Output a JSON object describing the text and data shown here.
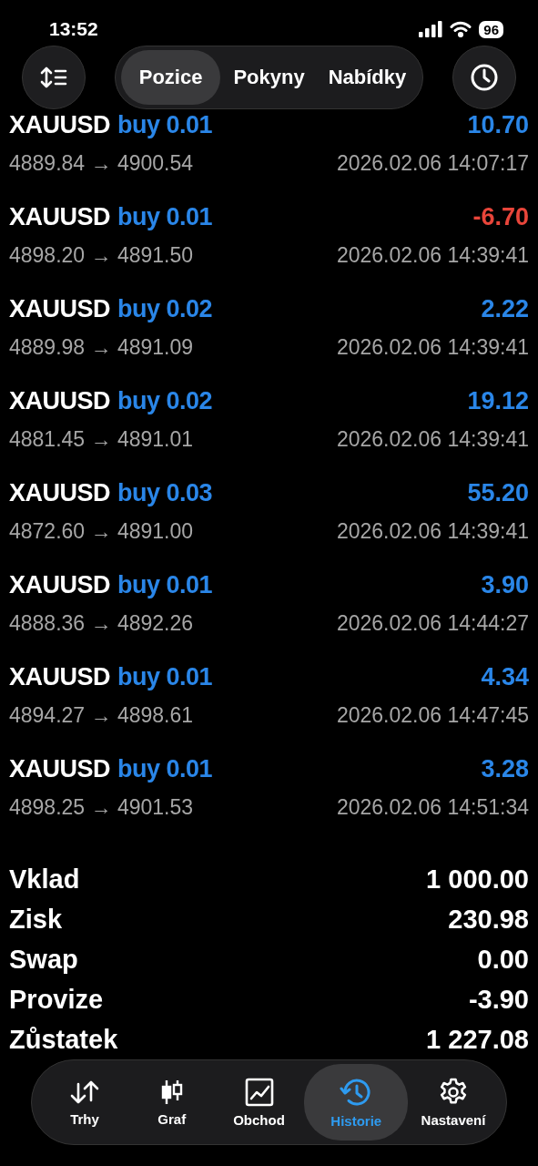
{
  "status_bar": {
    "time": "13:52",
    "battery": "96"
  },
  "header": {
    "tabs": [
      {
        "label": "Pozice",
        "selected": true
      },
      {
        "label": "Pokyny",
        "selected": false
      },
      {
        "label": "Nabídky",
        "selected": false
      }
    ]
  },
  "deals": [
    {
      "symbol": "XAUUSD",
      "side": "buy 0.01",
      "profit": "10.70",
      "kind": "gain",
      "prices": "4889.84 → 4900.54",
      "time": "2026.02.06 14:07:17"
    },
    {
      "symbol": "XAUUSD",
      "side": "buy 0.01",
      "profit": "-6.70",
      "kind": "loss",
      "prices": "4898.20 → 4891.50",
      "time": "2026.02.06 14:39:41"
    },
    {
      "symbol": "XAUUSD",
      "side": "buy 0.02",
      "profit": "2.22",
      "kind": "gain",
      "prices": "4889.98 → 4891.09",
      "time": "2026.02.06 14:39:41"
    },
    {
      "symbol": "XAUUSD",
      "side": "buy 0.02",
      "profit": "19.12",
      "kind": "gain",
      "prices": "4881.45 → 4891.01",
      "time": "2026.02.06 14:39:41"
    },
    {
      "symbol": "XAUUSD",
      "side": "buy 0.03",
      "profit": "55.20",
      "kind": "gain",
      "prices": "4872.60 → 4891.00",
      "time": "2026.02.06 14:39:41"
    },
    {
      "symbol": "XAUUSD",
      "side": "buy 0.01",
      "profit": "3.90",
      "kind": "gain",
      "prices": "4888.36 → 4892.26",
      "time": "2026.02.06 14:44:27"
    },
    {
      "symbol": "XAUUSD",
      "side": "buy 0.01",
      "profit": "4.34",
      "kind": "gain",
      "prices": "4894.27 → 4898.61",
      "time": "2026.02.06 14:47:45"
    },
    {
      "symbol": "XAUUSD",
      "side": "buy 0.01",
      "profit": "3.28",
      "kind": "gain",
      "prices": "4898.25 → 4901.53",
      "time": "2026.02.06 14:51:34"
    }
  ],
  "summary": [
    {
      "label": "Vklad",
      "value": "1 000.00"
    },
    {
      "label": "Zisk",
      "value": "230.98"
    },
    {
      "label": "Swap",
      "value": "0.00"
    },
    {
      "label": "Provize",
      "value": "-3.90"
    },
    {
      "label": "Zůstatek",
      "value": "1 227.08"
    }
  ],
  "tab_bar": [
    {
      "label": "Trhy",
      "kind": "updown",
      "selected": false
    },
    {
      "label": "Graf",
      "kind": "candles",
      "selected": false
    },
    {
      "label": "Obchod",
      "kind": "chart",
      "selected": false
    },
    {
      "label": "Historie",
      "kind": "history",
      "selected": true
    },
    {
      "label": "Nastavení",
      "kind": "gear",
      "selected": false
    }
  ]
}
